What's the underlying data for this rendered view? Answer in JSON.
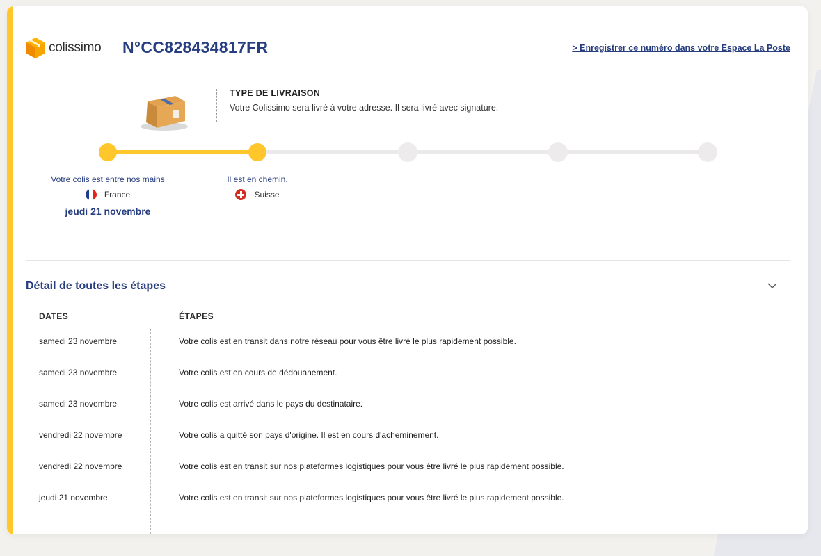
{
  "header": {
    "brand": "colissimo",
    "tracking_number": "N°CC828434817FR",
    "register_link": "> Enregistrer ce numéro dans votre Espace La Poste"
  },
  "delivery_type": {
    "title": "TYPE DE LIVRAISON",
    "description": "Votre Colissimo sera livré à votre adresse. Il sera livré avec signature."
  },
  "progress": {
    "completed_steps": 2,
    "total_steps": 5,
    "steps": [
      {
        "label": "Votre colis est entre nos mains",
        "country": "France",
        "date": "jeudi 21 novembre",
        "flag_icon": "france-flag-icon"
      },
      {
        "label": "Il est en chemin.",
        "country": "Suisse",
        "date": "",
        "flag_icon": "switzerland-flag-icon"
      }
    ]
  },
  "details": {
    "title": "Détail de toutes les étapes",
    "toggle_icon": "chevron-down-icon",
    "col_dates": "DATES",
    "col_steps": "ÉTAPES",
    "events": [
      {
        "date": "samedi 23 novembre",
        "text": "Votre colis est en transit dans notre réseau pour vous être livré le plus rapidement possible."
      },
      {
        "date": "samedi 23 novembre",
        "text": "Votre colis est en cours de dédouanement."
      },
      {
        "date": "samedi 23 novembre",
        "text": "Votre colis est arrivé dans le pays du destinataire."
      },
      {
        "date": "vendredi 22 novembre",
        "text": "Votre colis a quitté son pays d'origine. Il est en cours d'acheminement."
      },
      {
        "date": "vendredi 22 novembre",
        "text": "Votre colis est en transit sur nos plateformes logistiques pour vous être livré le plus rapidement possible."
      },
      {
        "date": "jeudi 21 novembre",
        "text": "Votre colis est en transit sur nos plateformes logistiques pour vous être livré le plus rapidement possible."
      }
    ]
  },
  "colors": {
    "accent_yellow": "#ffc72c",
    "brand_blue": "#263d80",
    "inactive_step": "#edebec"
  }
}
